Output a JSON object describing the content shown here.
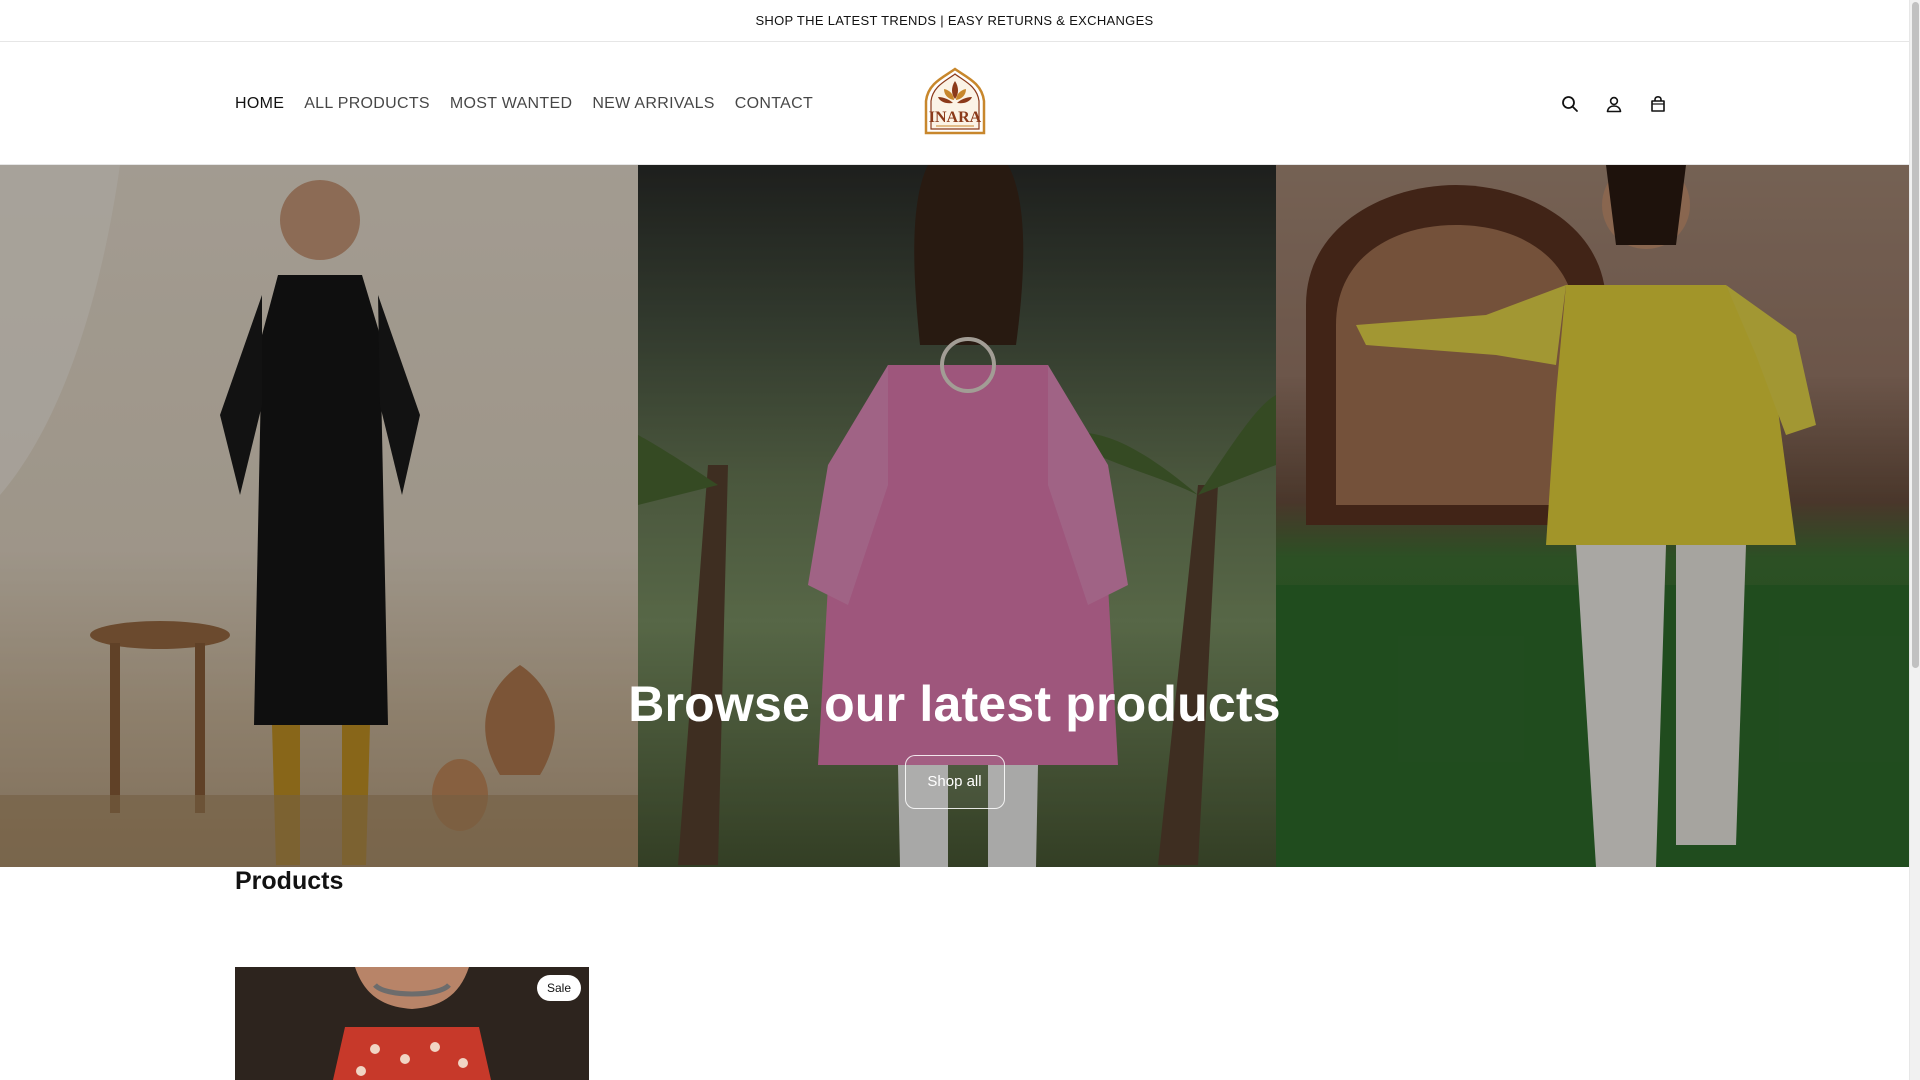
{
  "announcement": {
    "text": "SHOP THE LATEST TRENDS | EASY RETURNS & EXCHANGES"
  },
  "header": {
    "nav": [
      {
        "label": "HOME",
        "active": true
      },
      {
        "label": "ALL PRODUCTS",
        "active": false
      },
      {
        "label": "MOST WANTED",
        "active": false
      },
      {
        "label": "NEW ARRIVALS",
        "active": false
      },
      {
        "label": "CONTACT",
        "active": false
      }
    ],
    "logo_text": "INARA",
    "icons": [
      "search-icon",
      "account-icon",
      "cart-icon"
    ]
  },
  "hero": {
    "title": "Browse our latest products",
    "button_label": "Shop all"
  },
  "products": {
    "heading": "Products",
    "items": [
      {
        "badge": "Sale"
      }
    ]
  },
  "colors": {
    "text": "#121212",
    "logo_brown": "#8b3a1a",
    "logo_gold": "#c8872c",
    "background": "#ffffff"
  }
}
